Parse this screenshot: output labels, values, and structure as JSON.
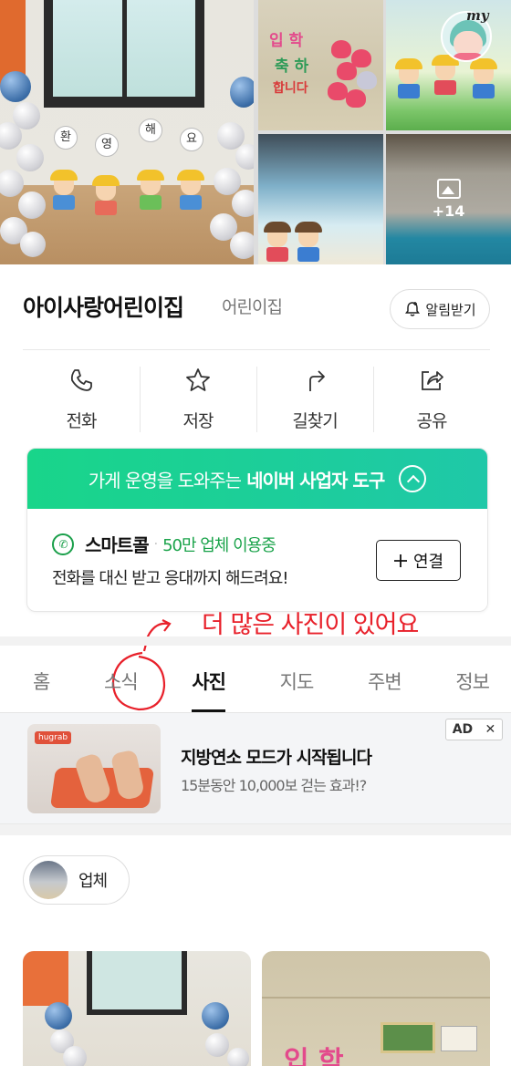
{
  "photos": {
    "main_letters": [
      "환",
      "영",
      "해",
      "요"
    ],
    "board_text_1": "입 학",
    "board_text_2": "축 하",
    "board_text_3": "합니다",
    "more_count": "+14",
    "my_label": "my"
  },
  "business": {
    "name": "아이사랑어린이집",
    "category": "어린이집",
    "notify_label": "알림받기"
  },
  "actions": [
    {
      "label": "전화",
      "icon": "phone-icon"
    },
    {
      "label": "저장",
      "icon": "star-icon"
    },
    {
      "label": "길찾기",
      "icon": "directions-icon"
    },
    {
      "label": "공유",
      "icon": "share-icon"
    }
  ],
  "tool": {
    "banner_prefix": "가게 운영을 도와주는",
    "banner_bold": "네이버 사업자 도구",
    "smartcall_name": "스마트콜",
    "smartcall_dot": "·",
    "smartcall_users": "50만 업체 이용중",
    "smartcall_desc": "전화를 대신 받고 응대까지 해드려요!",
    "connect_label": "연결",
    "accent_color": "#1bd18f"
  },
  "annotation": {
    "text": "더 많은 사진이 있어요",
    "color": "#e8202a"
  },
  "tabs": [
    {
      "label": "홈",
      "active": false
    },
    {
      "label": "소식",
      "active": false
    },
    {
      "label": "사진",
      "active": true
    },
    {
      "label": "지도",
      "active": false
    },
    {
      "label": "주변",
      "active": false
    },
    {
      "label": "정보",
      "active": false
    }
  ],
  "ad": {
    "brand": "hugrab",
    "title": "지방연소 모드가 시작됩니다",
    "subtitle": "15분동안 10,000보 걷는 효과!?",
    "badge": "AD",
    "close": "✕"
  },
  "filter": {
    "chip_label": "업체"
  },
  "gallery": {
    "board_text": "입 학"
  }
}
